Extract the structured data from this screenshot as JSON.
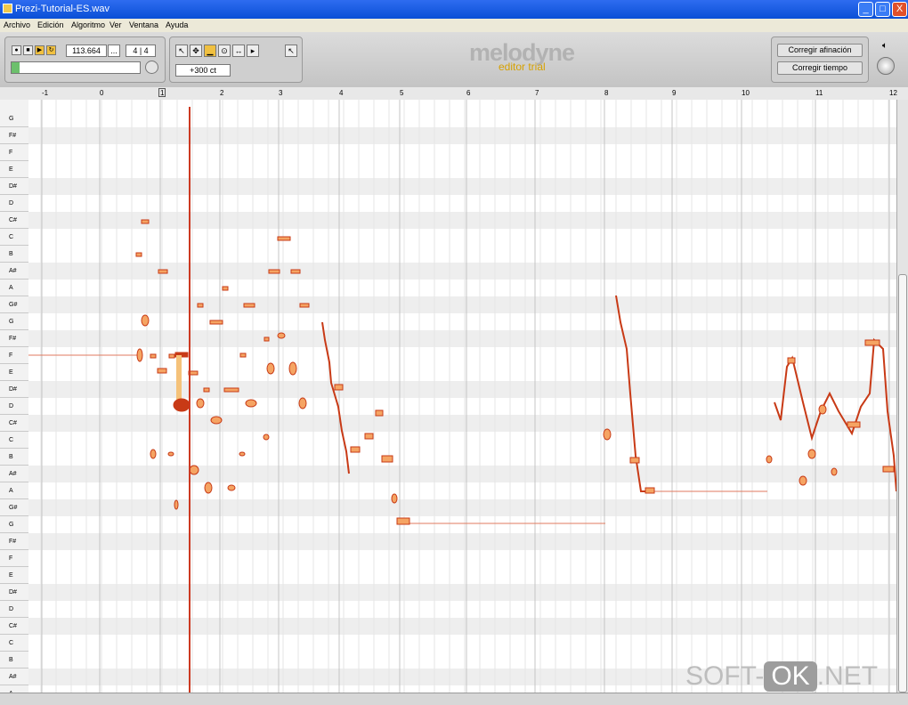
{
  "window": {
    "title": "Prezi-Tutorial-ES.wav"
  },
  "window_controls": {
    "minimize": "_",
    "maximize": "□",
    "close": "X"
  },
  "menu": [
    "Archivo",
    "Edición",
    "Algoritmo",
    "Ver",
    "Ventana",
    "Ayuda"
  ],
  "transport": {
    "record": "●",
    "stop": "■",
    "play": "▶",
    "loop": "↻",
    "tempo": "113.664",
    "tempo_more": "...",
    "time_signature": "4 | 4",
    "progress": 0.06
  },
  "tools": {
    "items": [
      "↖",
      "✥",
      "▁",
      "⊙",
      "↔",
      "▸"
    ],
    "pitch_offset": "+300 ct"
  },
  "brand": {
    "name": "melodyne",
    "edition": "editor trial"
  },
  "correction": {
    "pitch_button": "Corregir afinación",
    "timing_button": "Corregir tiempo"
  },
  "ruler": {
    "labels": [
      "-1",
      "0",
      "1",
      "2",
      "3",
      "4",
      "5",
      "6",
      "7",
      "8",
      "9",
      "10",
      "11",
      "12"
    ]
  },
  "keyboard": {
    "notes": [
      "G",
      "F#",
      "F",
      "E",
      "D#",
      "D",
      "C#",
      "C",
      "B",
      "A#",
      "A",
      "G#",
      "G",
      "F#",
      "F",
      "E",
      "D#",
      "D",
      "C#",
      "C",
      "B",
      "A#",
      "A",
      "G#",
      "G",
      "F#",
      "F",
      "E",
      "D#",
      "D",
      "C#",
      "C",
      "B",
      "A#",
      "A"
    ]
  },
  "colors": {
    "blob_fill": "#f5a463",
    "blob_stroke": "#c83a16",
    "playhead": "#cc3a22",
    "title_bar": "#0a4fd6"
  },
  "watermark": {
    "left": "SOFT-",
    "box": "OK",
    "right": ".NET"
  }
}
